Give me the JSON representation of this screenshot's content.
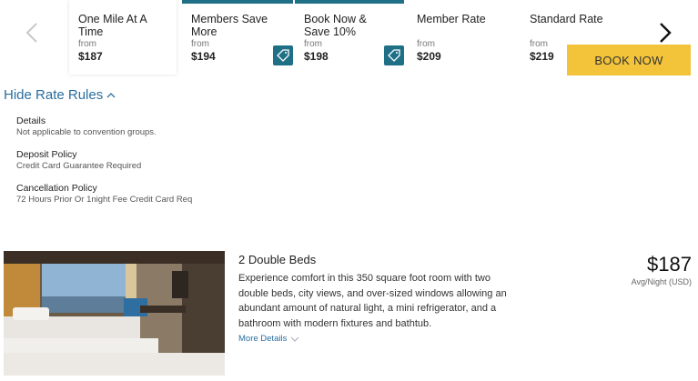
{
  "rates": [
    {
      "name": "One Mile At A Time",
      "from_label": "from",
      "price": "$187",
      "selected": true,
      "promo": false
    },
    {
      "name": "Members Save More",
      "from_label": "from",
      "price": "$194",
      "selected": false,
      "promo": true
    },
    {
      "name": "Book Now & Save 10%",
      "from_label": "from",
      "price": "$198",
      "selected": false,
      "promo": true
    },
    {
      "name": "Member Rate",
      "from_label": "from",
      "price": "$209",
      "selected": false,
      "promo": false
    },
    {
      "name": "Standard Rate",
      "from_label": "from",
      "price": "$219",
      "selected": false,
      "promo": false
    }
  ],
  "toggle_rules_label": "Hide Rate Rules",
  "rules": [
    {
      "title": "Details",
      "value": "Not applicable to convention groups."
    },
    {
      "title": "Deposit Policy",
      "value": "Credit Card Guarantee Required"
    },
    {
      "title": "Cancellation Policy",
      "value": "72 Hours Prior Or 1night Fee Credit Card Req"
    }
  ],
  "room": {
    "title": "2 Double Beds",
    "description": "Experience comfort in this 350 square foot room with two double beds, city views, and over-sized windows allowing an abundant amount of natural light, a mini refrigerator, and a bathroom with modern fixtures and bathtub.",
    "more_details_label": "More Details",
    "price": "$187",
    "price_unit": "Avg/Night (USD)",
    "book_label": "BOOK NOW"
  },
  "colors": {
    "accent_teal": "#1f6f86",
    "link_blue": "#2a6e9e",
    "book_yellow": "#f3c43a"
  },
  "icons": [
    "chevron-left-icon",
    "chevron-right-icon",
    "tag-icon",
    "chevron-up-icon",
    "chevron-down-icon"
  ]
}
